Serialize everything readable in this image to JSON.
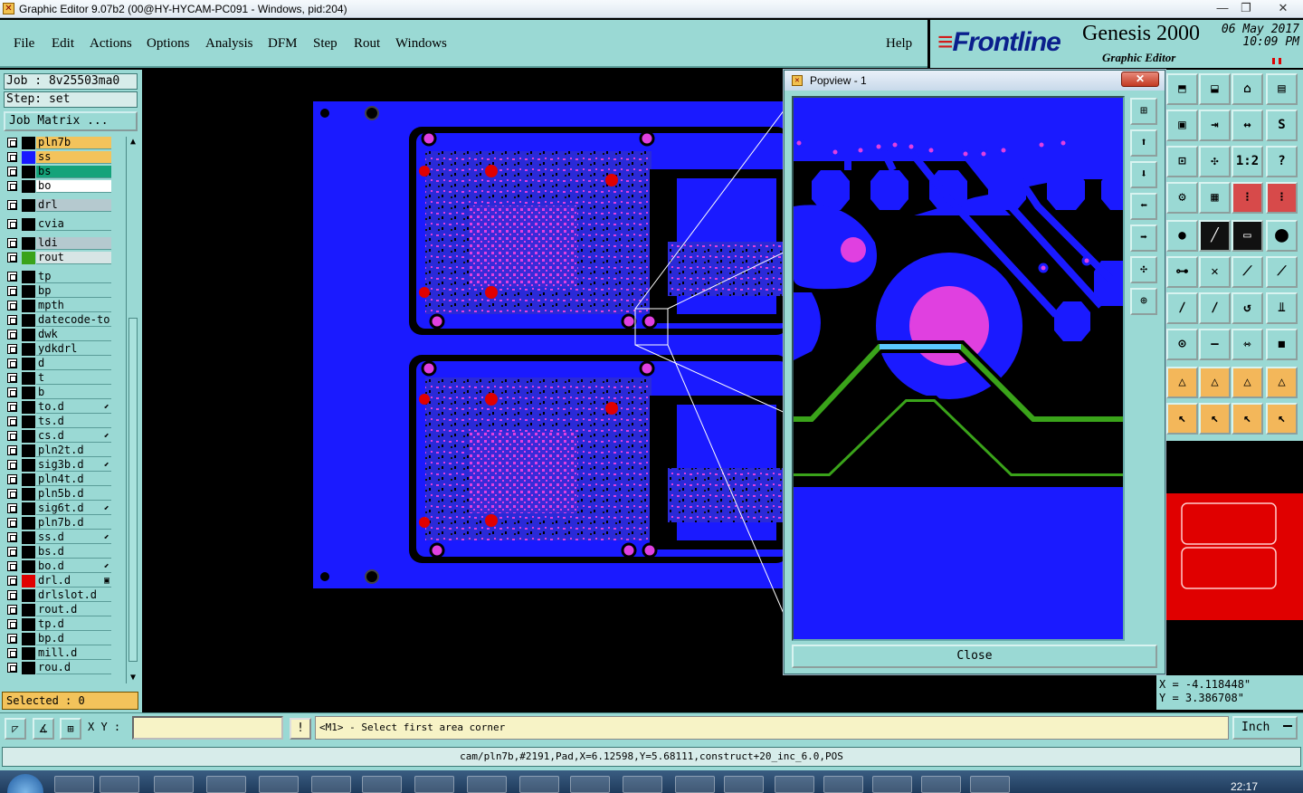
{
  "window": {
    "title": "Graphic Editor 9.07b2 (00@HY-HYCAM-PC091 - Windows, pid:204)",
    "minimize": "—",
    "maximize": "❐",
    "close": "✕"
  },
  "menu": [
    "File",
    "Edit",
    "Actions",
    "Options",
    "Analysis",
    "DFM",
    "Step",
    "Rout",
    "Windows"
  ],
  "help": "Help",
  "logo": {
    "brand": "Frontline",
    "product": "Genesis 2000",
    "subtitle": "Graphic Editor",
    "date": "06 May 2017",
    "time": "10:09 PM"
  },
  "job": "Job  : 8v25503ma0",
  "step": "Step: set",
  "job_matrix": "Job Matrix ...",
  "layers": [
    {
      "name": "pln7b",
      "swatch": "#000000",
      "bg": "#f3c35b"
    },
    {
      "name": "ss",
      "swatch": "#1a1aff",
      "bg": "#f3c35b"
    },
    {
      "name": "bs",
      "swatch": "#000000",
      "bg": "#14a37a"
    },
    {
      "name": "bo",
      "swatch": "#000000",
      "bg": "#ffffff"
    },
    {
      "name": "drl",
      "swatch": "#000000",
      "bg": "#b5c9cf"
    },
    {
      "name": "cvia",
      "swatch": "#000000",
      "bg": "#9ad9d4"
    },
    {
      "name": "ldi",
      "swatch": "#000000",
      "bg": "#b5c9cf"
    },
    {
      "name": "rout",
      "swatch": "#3aa31a",
      "bg": "#d7e5e5"
    },
    {
      "name": "tp",
      "swatch": "#000000",
      "bg": "#9ad9d4"
    },
    {
      "name": "bp",
      "swatch": "#000000",
      "bg": "#9ad9d4"
    },
    {
      "name": "mpth",
      "swatch": "#000000",
      "bg": "#9ad9d4"
    },
    {
      "name": "datecode-to",
      "swatch": "#000000",
      "bg": "#9ad9d4"
    },
    {
      "name": "dwk",
      "swatch": "#000000",
      "bg": "#9ad9d4"
    },
    {
      "name": "ydkdrl",
      "swatch": "#000000",
      "bg": "#9ad9d4"
    },
    {
      "name": "d",
      "swatch": "#000000",
      "bg": "#9ad9d4"
    },
    {
      "name": "t",
      "swatch": "#000000",
      "bg": "#9ad9d4"
    },
    {
      "name": "b",
      "swatch": "#000000",
      "bg": "#9ad9d4"
    },
    {
      "name": "to.d",
      "swatch": "#000000",
      "bg": "#9ad9d4",
      "mark": "⬋"
    },
    {
      "name": "ts.d",
      "swatch": "#000000",
      "bg": "#9ad9d4"
    },
    {
      "name": "cs.d",
      "swatch": "#000000",
      "bg": "#9ad9d4",
      "mark": "⬋"
    },
    {
      "name": "pln2t.d",
      "swatch": "#000000",
      "bg": "#9ad9d4"
    },
    {
      "name": "sig3b.d",
      "swatch": "#000000",
      "bg": "#9ad9d4",
      "mark": "⬋"
    },
    {
      "name": "pln4t.d",
      "swatch": "#000000",
      "bg": "#9ad9d4"
    },
    {
      "name": "pln5b.d",
      "swatch": "#000000",
      "bg": "#9ad9d4"
    },
    {
      "name": "sig6t.d",
      "swatch": "#000000",
      "bg": "#9ad9d4",
      "mark": "⬋"
    },
    {
      "name": "pln7b.d",
      "swatch": "#000000",
      "bg": "#9ad9d4"
    },
    {
      "name": "ss.d",
      "swatch": "#000000",
      "bg": "#9ad9d4",
      "mark": "⬋"
    },
    {
      "name": "bs.d",
      "swatch": "#000000",
      "bg": "#9ad9d4"
    },
    {
      "name": "bo.d",
      "swatch": "#000000",
      "bg": "#9ad9d4",
      "mark": "⬋"
    },
    {
      "name": "drl.d",
      "swatch": "#e00000",
      "bg": "#9ad9d4",
      "mark": "▣"
    },
    {
      "name": "drlslot.d",
      "swatch": "#000000",
      "bg": "#9ad9d4"
    },
    {
      "name": "rout.d",
      "swatch": "#000000",
      "bg": "#9ad9d4"
    },
    {
      "name": "tp.d",
      "swatch": "#000000",
      "bg": "#9ad9d4"
    },
    {
      "name": "bp.d",
      "swatch": "#000000",
      "bg": "#9ad9d4"
    },
    {
      "name": "mill.d",
      "swatch": "#000000",
      "bg": "#9ad9d4"
    },
    {
      "name": "rou.d",
      "swatch": "#000000",
      "bg": "#9ad9d4"
    }
  ],
  "selected": "Selected : 0",
  "popview": {
    "title": "Popview - 1",
    "close_x": "✕",
    "close": "Close"
  },
  "coords": {
    "x": "X = -4.118448\"",
    "y": "Y = 3.386708\""
  },
  "command": {
    "xy_label": "X Y :",
    "xy_value": "",
    "bang": "!",
    "prompt": "<M1> - Select first area corner",
    "unit": "Inch"
  },
  "status": "cam/pln7b,#2191,Pad,X=6.12598,Y=5.68111,construct+20_inc_6.0,POS",
  "taskbar": {
    "time": "22:17"
  },
  "colors": {
    "panel": "#9ad9d4",
    "copper": "#1a1aff",
    "pad": "#e040e0",
    "drill": "#e00000",
    "rout": "#3aa31a"
  }
}
